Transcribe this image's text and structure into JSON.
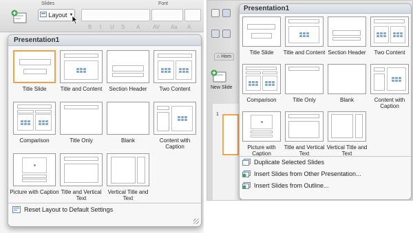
{
  "left": {
    "ribbon": {
      "slides_group_label": "Slides",
      "font_group_label": "Font",
      "layout_button_label": "Layout",
      "tool_glyphs": [
        "B",
        "I",
        "U",
        "S",
        "A",
        "AV",
        "Aa",
        "A"
      ]
    },
    "menu": {
      "title": "Presentation1",
      "layouts": [
        {
          "label": "Title Slide",
          "kind": "title",
          "selected": true
        },
        {
          "label": "Title and Content",
          "kind": "title-content",
          "selected": false
        },
        {
          "label": "Section Header",
          "kind": "section",
          "selected": false
        },
        {
          "label": "Two Content",
          "kind": "two-content",
          "selected": false
        },
        {
          "label": "Comparison",
          "kind": "comparison",
          "selected": false
        },
        {
          "label": "Title Only",
          "kind": "title-only",
          "selected": false
        },
        {
          "label": "Blank",
          "kind": "blank",
          "selected": false
        },
        {
          "label": "Content with Caption",
          "kind": "content-caption",
          "selected": false
        },
        {
          "label": "Picture with Caption",
          "kind": "picture-caption",
          "selected": false
        },
        {
          "label": "Title and Vertical Text",
          "kind": "vertical-text",
          "selected": false
        },
        {
          "label": "Vertical Title and Text",
          "kind": "vertical-title",
          "selected": false
        }
      ],
      "reset_label": "Reset Layout to Default Settings"
    }
  },
  "right": {
    "home_tab_label": "Hom",
    "new_slide_label": "New Slide",
    "slide_number": "1",
    "menu": {
      "title": "Presentation1",
      "layouts": [
        {
          "label": "Title Slide",
          "kind": "title"
        },
        {
          "label": "Title and Content",
          "kind": "title-content"
        },
        {
          "label": "Section Header",
          "kind": "section"
        },
        {
          "label": "Two Content",
          "kind": "two-content"
        },
        {
          "label": "Comparison",
          "kind": "comparison"
        },
        {
          "label": "Title Only",
          "kind": "title-only"
        },
        {
          "label": "Blank",
          "kind": "blank"
        },
        {
          "label": "Content with Caption",
          "kind": "content-caption"
        },
        {
          "label": "Picture with Caption",
          "kind": "picture-caption"
        },
        {
          "label": "Title and Vertical Text",
          "kind": "vertical-text"
        },
        {
          "label": "Vertical Title and Text",
          "kind": "vertical-title"
        }
      ],
      "actions": [
        {
          "label": "Duplicate Selected Slides",
          "icon": "duplicate-slides-icon"
        },
        {
          "label": "Insert Slides from Other Presentation...",
          "icon": "insert-presentation-icon"
        },
        {
          "label": "Insert Slides from Outline...",
          "icon": "insert-outline-icon"
        }
      ]
    }
  },
  "colors": {
    "selection_orange": "#f0a24a",
    "placeholder_icon_blue": "#7fa6cf",
    "menu_header": "#d3d8df"
  }
}
